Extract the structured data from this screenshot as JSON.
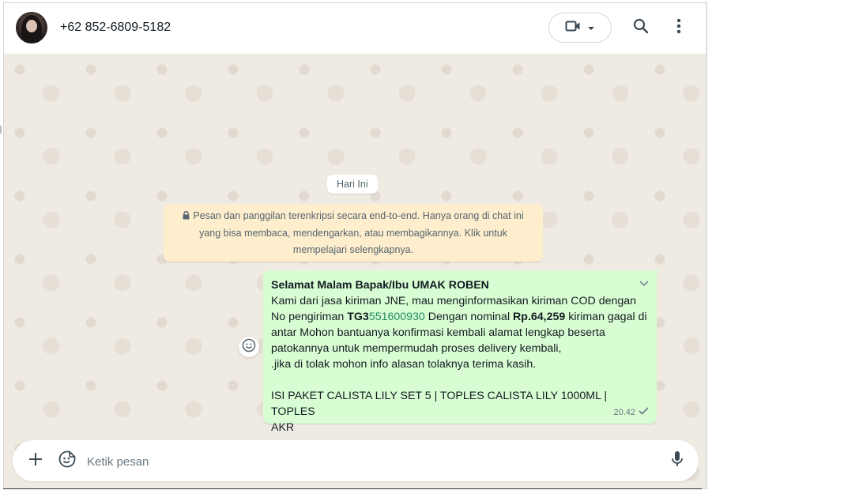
{
  "header": {
    "contact_name": "+62 852-6809-5182",
    "icons": {
      "video": "video-call-icon",
      "dropdown": "chevron-down-icon",
      "search": "search-icon",
      "menu": "more-vert-icon"
    }
  },
  "chat": {
    "date_chip": "Hari Ini",
    "encryption_notice": "Pesan dan panggilan terenkripsi secara end-to-end. Hanya orang di chat ini yang bisa membaca, mendengarkan, atau membagikannya. Klik untuk mempelajari selengkapnya.",
    "message": {
      "title": "Selamat Malam Bapak/Ibu UMAK ROBEN",
      "line1": "Kami dari jasa kiriman JNE, mau menginformasikan kiriman COD dengan",
      "line2_a": "No pengiriman ",
      "tracking_prefix": "TG3",
      "tracking_number": "551600930",
      "line2_b": " Dengan nominal ",
      "amount": "Rp.64,259",
      "line2_c": " kiriman gagal di",
      "line3": "antar Mohon bantuanya konfirmasi kembali alamat lengkap beserta",
      "line4": "patokannya untuk mempermudah proses delivery kembali,",
      "line5": " .jika di tolak mohon info alasan tolaknya terima kasih.",
      "line6": "ISI PAKET CALISTA LILY SET 5 | TOPLES CALISTA LILY 1000ML | TOPLES",
      "line7": "AKR",
      "time": "20.42",
      "status": "sent"
    }
  },
  "composer": {
    "placeholder": "Ketik pesan"
  },
  "colors": {
    "chat_background": "#efeae2",
    "outgoing_bubble": "#d9fdd3",
    "notice_background": "#ffeecd",
    "tracking_link": "#1f8a5b"
  }
}
